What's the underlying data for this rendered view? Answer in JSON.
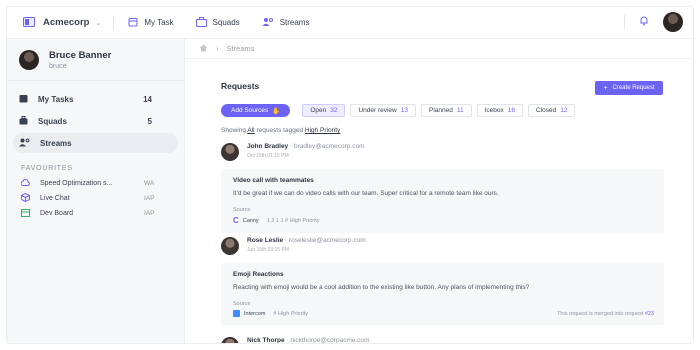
{
  "topbar": {
    "org_name": "Acmecorp",
    "nav": [
      {
        "label": "My Task",
        "icon": "calendar-icon"
      },
      {
        "label": "Squads",
        "icon": "briefcase-icon"
      },
      {
        "label": "Streams",
        "icon": "users-icon"
      }
    ]
  },
  "sidebar": {
    "user_name": "Bruce Banner",
    "user_handle": "bruce",
    "items": [
      {
        "label": "My Tasks",
        "count": "14"
      },
      {
        "label": "Squads",
        "count": "5"
      },
      {
        "label": "Streams",
        "count": ""
      }
    ],
    "favourites_title": "FAVOURITES",
    "favourites": [
      {
        "label": "Speed Optimization s...",
        "tag": "WA"
      },
      {
        "label": "Live Chat",
        "tag": "IAP"
      },
      {
        "label": "Dev Board",
        "tag": "IAP"
      }
    ]
  },
  "main": {
    "breadcrumb": "Streams",
    "title": "Requests",
    "create_label": "Create Request",
    "add_sources_label": "Add Sources",
    "filters": [
      {
        "label": "Open",
        "count": "32"
      },
      {
        "label": "Under review",
        "count": "13"
      },
      {
        "label": "Planned",
        "count": "11"
      },
      {
        "label": "Icebox",
        "count": "16"
      },
      {
        "label": "Closed",
        "count": "12"
      }
    ],
    "showing_prefix": "Showing",
    "showing_all": "All",
    "showing_mid": "requests tagged",
    "showing_tag": "High Priority",
    "requests": [
      {
        "name": "John Bradley",
        "email": "· bradley@acmecorp.com",
        "time": "Oct 15th,01:15 PM",
        "title": "Video call with teammates",
        "body": "It'd be great if we can do video calls with our team. Super critical for a remote team like ours.",
        "source_label": "Source",
        "source_name": "Canny",
        "source_meta": "1   2   1   1      # High Priority",
        "merged": ""
      },
      {
        "name": "Rose Leslie",
        "email": "· roseleslie@acmecorp.com",
        "time": "Jun 15th,03:15 PM",
        "title": "Emoji Reactions",
        "body": "Reacting with emoji would be a cool addition to the existing like button. Any plans of implementing this?",
        "source_label": "Source",
        "source_name": "Intercom",
        "source_meta": "# High Priority",
        "merged": "This request is merged into request",
        "merged_ref": "#23"
      },
      {
        "name": "Nick Thorpe",
        "email": "· nickthorpe@corpacme.com",
        "time": ""
      }
    ]
  },
  "colors": {
    "accent": "#6c63f5",
    "sidebar_bg": "#f6f7f9"
  }
}
